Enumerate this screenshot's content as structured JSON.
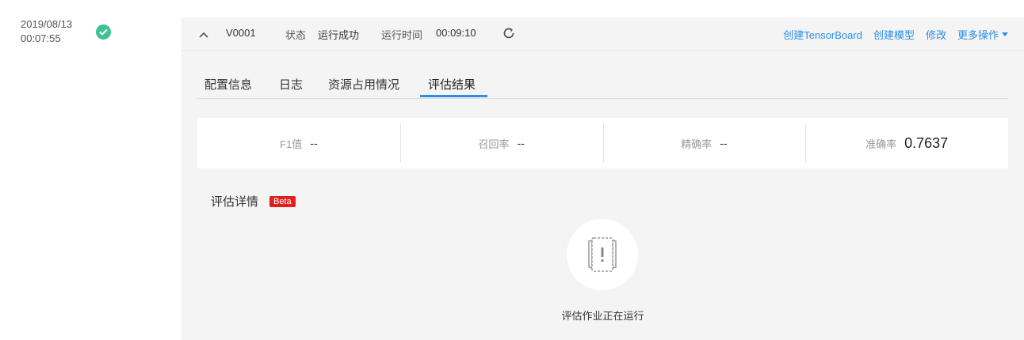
{
  "timeline": {
    "date": "2019/08/13",
    "time": "00:07:55",
    "status_icon": "check-circle-icon",
    "status_color": "#3ec293"
  },
  "header": {
    "version": "V0001",
    "status_label": "状态",
    "status_value": "运行成功",
    "runtime_label": "运行时间",
    "runtime_value": "00:09:10",
    "actions": {
      "tensorboard": "创建TensorBoard",
      "create_model": "创建模型",
      "edit": "修改",
      "more": "更多操作"
    },
    "accent": "#2b8ee8"
  },
  "tabs": [
    "配置信息",
    "日志",
    "资源占用情况",
    "评估结果"
  ],
  "active_tab": "评估结果",
  "metrics": [
    {
      "label": "F1值",
      "value": "--"
    },
    {
      "label": "召回率",
      "value": "--"
    },
    {
      "label": "精确率",
      "value": "--"
    },
    {
      "label": "准确率",
      "value": "0.7637"
    }
  ],
  "detail": {
    "title": "评估详情",
    "badge": "Beta",
    "badge_color": "#e02020"
  },
  "empty_state": {
    "icon": "document-warning-icon",
    "message": "评估作业正在运行"
  }
}
